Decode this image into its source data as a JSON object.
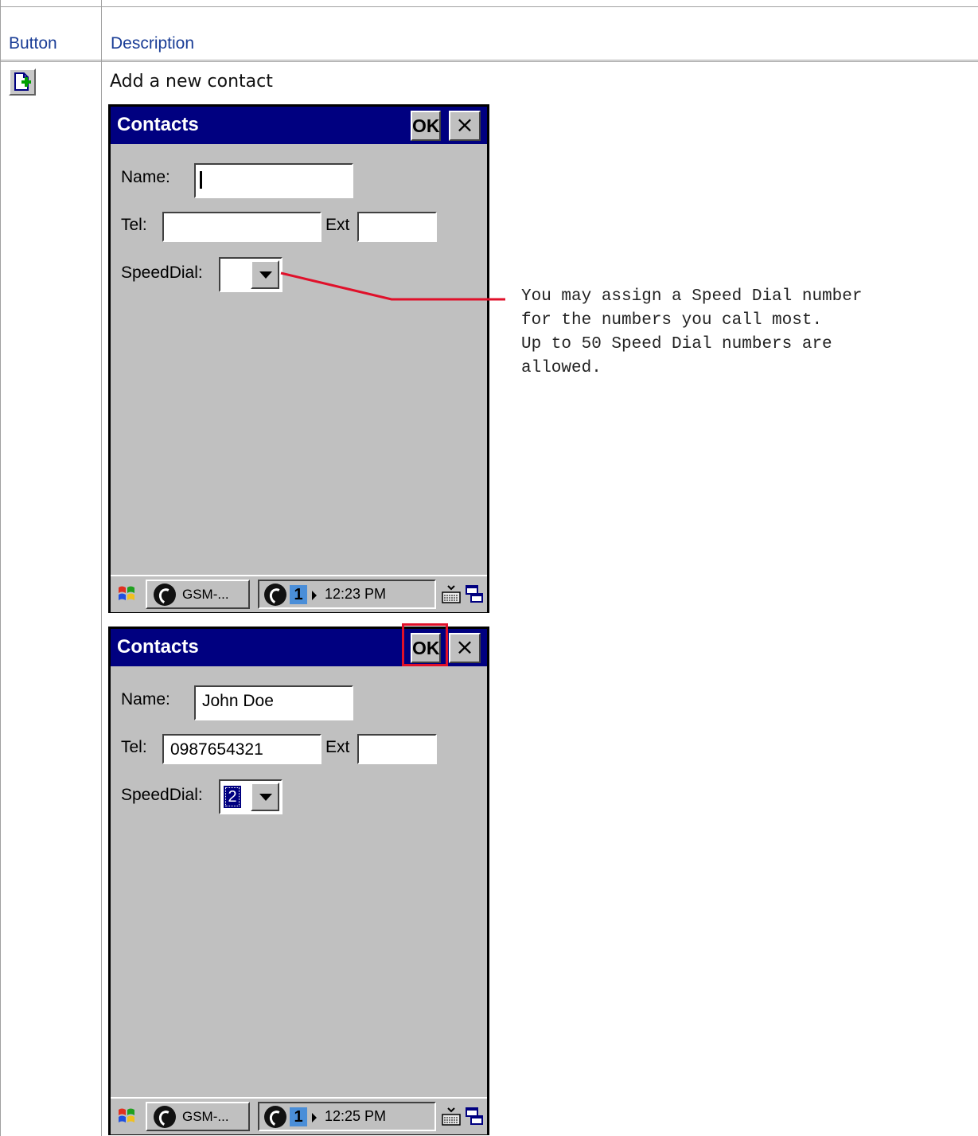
{
  "table": {
    "headers": {
      "button": "Button",
      "description": "Description"
    },
    "row": {
      "icon": "add-contact-icon",
      "description": "Add a new contact"
    }
  },
  "screen1": {
    "title": "Contacts",
    "ok_label": "OK",
    "close_label": "×",
    "fields": {
      "name_label": "Name:",
      "name_value": "",
      "tel_label": "Tel:",
      "tel_value": "",
      "ext_label": "Ext",
      "ext_value": "",
      "speed_label": "SpeedDial:",
      "speed_value": ""
    },
    "taskbar": {
      "task_label": "GSM-...",
      "tray_number": "1",
      "time": "12:23 PM"
    }
  },
  "screen2": {
    "title": "Contacts",
    "ok_label": "OK",
    "close_label": "×",
    "fields": {
      "name_label": "Name:",
      "name_value": "John Doe",
      "tel_label": "Tel:",
      "tel_value": "0987654321",
      "ext_label": "Ext",
      "ext_value": "",
      "speed_label": "SpeedDial:",
      "speed_value": "2"
    },
    "taskbar": {
      "task_label": "GSM-...",
      "tray_number": "1",
      "time": "12:25 PM"
    }
  },
  "callout": {
    "text": "You may assign a Speed Dial number\nfor the numbers you call most.\nUp to 50 Speed Dial numbers are\nallowed."
  },
  "colors": {
    "header_text": "#1a3d96",
    "titlebar": "#000080",
    "window_bg": "#c0c0c0",
    "annotation": "#e0102a"
  }
}
